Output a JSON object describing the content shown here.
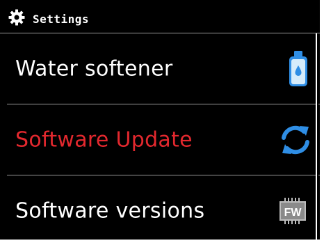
{
  "header": {
    "title": "Settings",
    "icon": "gear-icon"
  },
  "menu": {
    "items": [
      {
        "label": "Water softener",
        "icon": "water-bottle-icon",
        "active": false
      },
      {
        "label": "Software Update",
        "icon": "sync-icon",
        "active": true
      },
      {
        "label": "Software versions",
        "icon": "firmware-chip-icon",
        "icon_text": "FW",
        "active": false
      }
    ]
  },
  "colors": {
    "background": "#000000",
    "text": "#ffffff",
    "active_text": "#e3282e",
    "accent_blue": "#2f8ee5",
    "divider": "#9a9a9a"
  }
}
